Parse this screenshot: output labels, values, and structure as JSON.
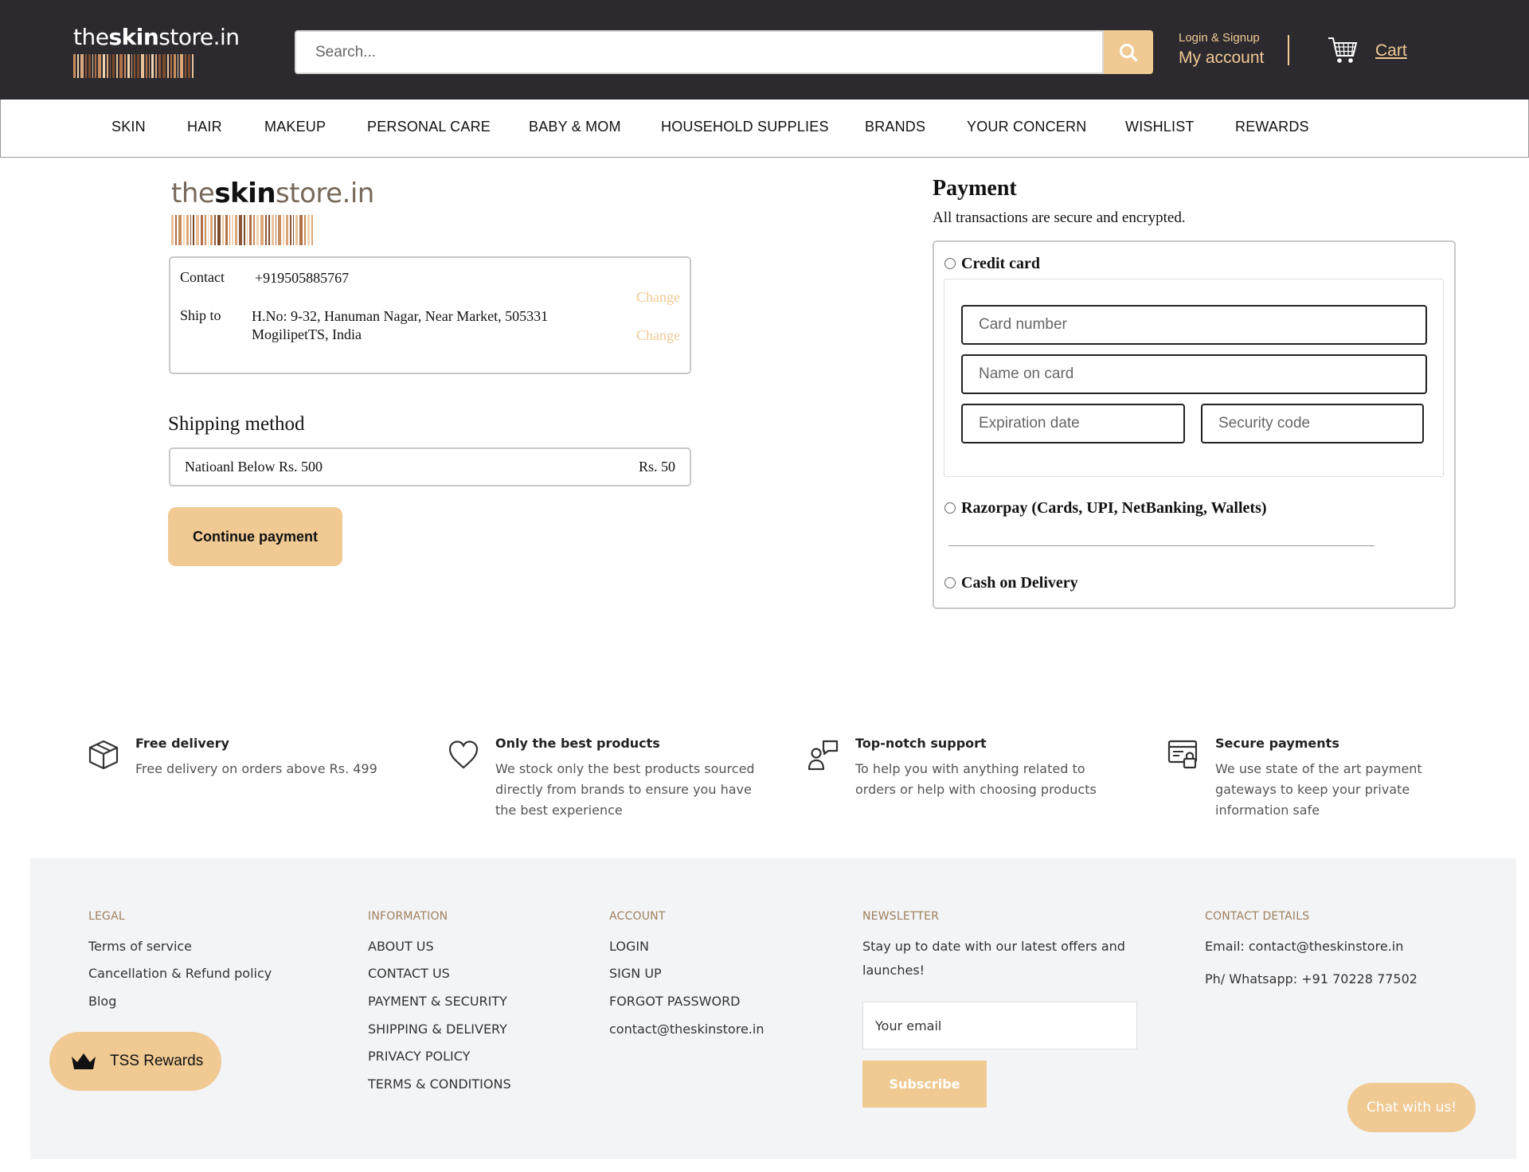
{
  "header": {
    "logo_text_a": "the",
    "logo_text_b": "skin",
    "logo_text_c": "store.in",
    "search_placeholder": "Search...",
    "login_label": "Login & Signup",
    "account_label": "My account",
    "cart_label": "Cart"
  },
  "nav": {
    "items": [
      "SKIN",
      "HAIR",
      "MAKEUP",
      "PERSONAL CARE",
      "BABY & MOM",
      "HOUSEHOLD SUPPLIES",
      "BRANDS",
      "YOUR CONCERN",
      "WISHLIST",
      "REWARDS"
    ]
  },
  "checkout": {
    "contact_label": "Contact",
    "contact_value": "+919505885767",
    "ship_label": "Ship to",
    "ship_line1": "H.No: 9-32, Hanuman Nagar, Near Market, 505331",
    "ship_line2": "MogilipetTS, India",
    "change_label": "Change",
    "shipping_title": "Shipping method",
    "shipping_name": "Natioanl Below Rs. 500",
    "shipping_price": "Rs. 50",
    "continue_label": "Continue payment"
  },
  "payment": {
    "title": "Payment",
    "subtitle": "All transactions are secure and encrypted.",
    "options": [
      "Credit card",
      "Razorpay (Cards, UPI, NetBanking, Wallets)",
      "Cash on Delivery"
    ],
    "card_number_placeholder": "Card number",
    "name_placeholder": "Name on card",
    "expiry_placeholder": "Expiration date",
    "security_placeholder": "Security code"
  },
  "features": [
    {
      "icon": "box-icon",
      "title": "Free delivery",
      "desc": "Free delivery on orders above Rs. 499"
    },
    {
      "icon": "heart-icon",
      "title": "Only the best products",
      "desc": "We stock only the best products sourced directly from brands to ensure you have the best experience"
    },
    {
      "icon": "support-icon",
      "title": "Top-notch support",
      "desc": "To help you with anything related to orders or help with choosing products"
    },
    {
      "icon": "secure-payment-icon",
      "title": "Secure payments",
      "desc": "We use state of the art payment gateways to keep your private information safe"
    }
  ],
  "footer": {
    "legal": {
      "heading": "LEGAL",
      "links": [
        "Terms of service",
        "Cancellation & Refund policy",
        "Blog"
      ]
    },
    "information": {
      "heading": "INFORMATION",
      "links": [
        "ABOUT US",
        "CONTACT US",
        "PAYMENT & SECURITY",
        "SHIPPING & DELIVERY",
        "PRIVACY POLICY",
        "TERMS & CONDITIONS"
      ]
    },
    "account": {
      "heading": "ACCOUNT",
      "links": [
        "LOGIN",
        "SIGN UP",
        "FORGOT PASSWORD",
        "contact@theskinstore.in"
      ]
    },
    "newsletter": {
      "heading": "NEWSLETTER",
      "text": "Stay up to date with our latest offers and launches!",
      "email_placeholder": "Your email",
      "subscribe_label": "Subscribe"
    },
    "contact": {
      "heading": "CONTACT DETAILS",
      "email": "Email: contact@theskinstore.in",
      "phone": "Ph/ Whatsapp: +91 70228 77502"
    }
  },
  "widgets": {
    "rewards_label": "TSS Rewards",
    "chat_label": "Chat with us!"
  },
  "colors": {
    "header_bg": "#2c2a2f",
    "accent": "#f0c993",
    "footer_bg": "#f3f4f6"
  }
}
